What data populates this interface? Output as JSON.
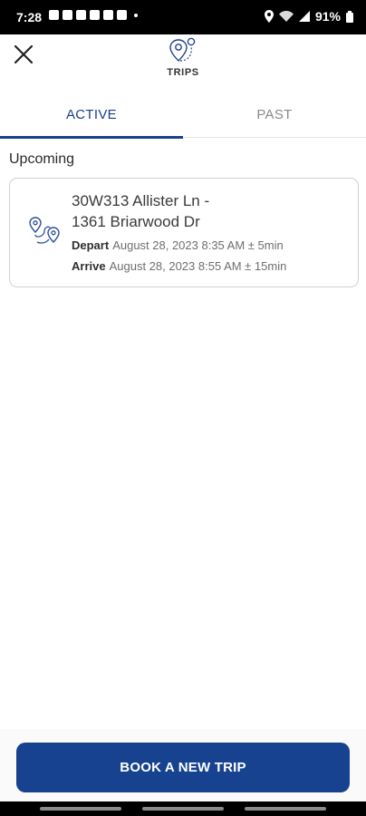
{
  "status_bar": {
    "time": "7:28",
    "battery": "91%"
  },
  "header": {
    "title": "TRIPS",
    "icon": "trips-pin-icon"
  },
  "tabs": [
    {
      "label": "ACTIVE",
      "active": true
    },
    {
      "label": "PAST",
      "active": false
    }
  ],
  "section": {
    "title": "Upcoming"
  },
  "trip": {
    "route_line1": "30W313 Allister Ln -",
    "route_line2": "1361 Briarwood Dr",
    "depart_label": "Depart",
    "depart_value": "August 28, 2023 8:35 AM ± 5min",
    "arrive_label": "Arrive",
    "arrive_value": "August 28, 2023 8:55 AM ± 15min",
    "icon": "route-icon"
  },
  "actions": {
    "book_label": "BOOK A NEW TRIP"
  },
  "colors": {
    "accent": "#1c3f8c",
    "button": "#17428f",
    "inactive_tab": "#8a8a8a"
  }
}
